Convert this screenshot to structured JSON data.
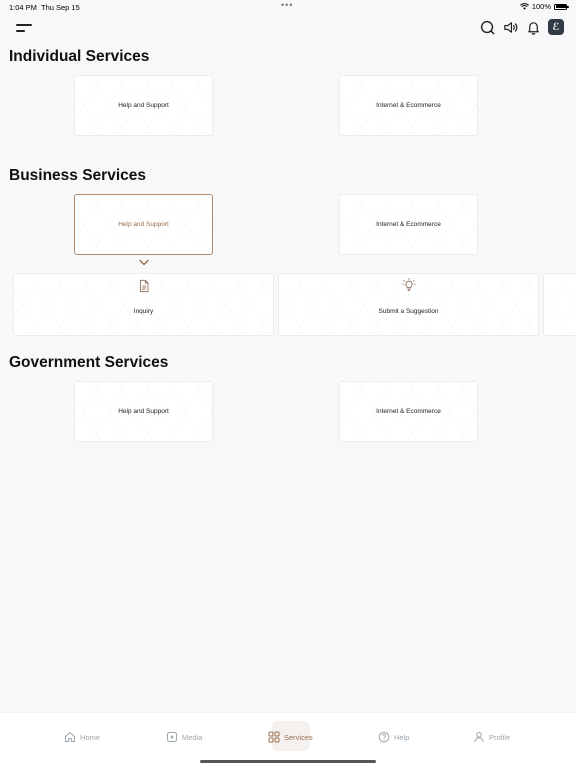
{
  "status": {
    "time": "1:04 PM",
    "date": "Thu Sep 15",
    "battery": "100%"
  },
  "header": {
    "brand_initial": "ℰ",
    "icons": [
      "menu-icon",
      "search-icon",
      "speaker-icon",
      "bell-icon"
    ]
  },
  "sections": {
    "individual": {
      "title": "Individual Services",
      "cards": [
        "Help and Support",
        "Internet & Ecommerce"
      ]
    },
    "business": {
      "title": "Business Services",
      "cards": [
        "Help and Support",
        "Internet & Ecommerce"
      ],
      "sub_items": [
        "Inquiry",
        "Submit a Suggestion"
      ]
    },
    "government": {
      "title": "Government Services",
      "cards": [
        "Help and Support",
        "Internet & Ecommerce"
      ]
    }
  },
  "nav": {
    "items": [
      "Home",
      "Media",
      "Services",
      "Help",
      "Profile"
    ],
    "active": "Services"
  },
  "colors": {
    "accent": "#9b6f4e",
    "background": "#f8f8fa",
    "nav_inactive": "#9aa5ad"
  }
}
